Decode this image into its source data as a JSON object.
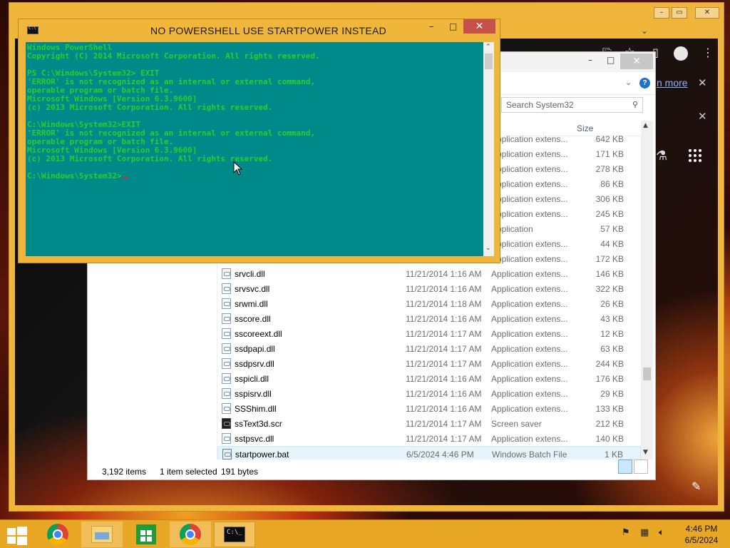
{
  "cmd": {
    "title": "NO POWERSHELL USE STARTPOWER INSTEAD",
    "lines": [
      "Windows PowerShell",
      "Copyright (C) 2014 Microsoft Corporation. All rights reserved.",
      "",
      "PS C:\\Windows\\System32> EXIT",
      "'ERROR' is not recognized as an internal or external command,",
      "operable program or batch file.",
      "Microsoft Windows [Version 6.3.9600]",
      "(c) 2013 Microsoft Corporation. All rights reserved.",
      "",
      "C:\\Windows\\System32>EXIT",
      "'ERROR' is not recognized as an internal or external command,",
      "operable program or batch file.",
      "Microsoft Windows [Version 6.3.9600]",
      "(c) 2013 Microsoft Corporation. All rights reserved.",
      "",
      "C:\\Windows\\System32>"
    ]
  },
  "chrome": {
    "learn_more": "n more"
  },
  "explorer": {
    "search_placeholder": "Search System32",
    "columns": {
      "type": "pe",
      "size": "Size"
    },
    "files": [
      {
        "name": "",
        "date": "",
        "type": "Application extens...",
        "size": "642 KB",
        "icon": "dll"
      },
      {
        "name": "",
        "date": "",
        "type": "Application extens...",
        "size": "171 KB",
        "icon": "dll"
      },
      {
        "name": "",
        "date": "",
        "type": "Application extens...",
        "size": "278 KB",
        "icon": "dll"
      },
      {
        "name": "",
        "date": "",
        "type": "Application extens...",
        "size": "86 KB",
        "icon": "dll"
      },
      {
        "name": "",
        "date": "",
        "type": "Application extens...",
        "size": "306 KB",
        "icon": "dll"
      },
      {
        "name": "",
        "date": "",
        "type": "Application extens...",
        "size": "245 KB",
        "icon": "dll"
      },
      {
        "name": "",
        "date": "",
        "type": "Application",
        "size": "57 KB",
        "icon": "dll"
      },
      {
        "name": "",
        "date": "",
        "type": "Application extens...",
        "size": "44 KB",
        "icon": "dll"
      },
      {
        "name": "",
        "date": "",
        "type": "Application extens...",
        "size": "172 KB",
        "icon": "dll"
      },
      {
        "name": "srvcli.dll",
        "date": "11/21/2014 1:16 AM",
        "type": "Application extens...",
        "size": "146 KB",
        "icon": "dll"
      },
      {
        "name": "srvsvc.dll",
        "date": "11/21/2014 1:16 AM",
        "type": "Application extens...",
        "size": "322 KB",
        "icon": "dll"
      },
      {
        "name": "srwmi.dll",
        "date": "11/21/2014 1:18 AM",
        "type": "Application extens...",
        "size": "26 KB",
        "icon": "dll"
      },
      {
        "name": "sscore.dll",
        "date": "11/21/2014 1:16 AM",
        "type": "Application extens...",
        "size": "43 KB",
        "icon": "dll"
      },
      {
        "name": "sscoreext.dll",
        "date": "11/21/2014 1:17 AM",
        "type": "Application extens...",
        "size": "12 KB",
        "icon": "dll"
      },
      {
        "name": "ssdpapi.dll",
        "date": "11/21/2014 1:17 AM",
        "type": "Application extens...",
        "size": "63 KB",
        "icon": "dll"
      },
      {
        "name": "ssdpsrv.dll",
        "date": "11/21/2014 1:17 AM",
        "type": "Application extens...",
        "size": "244 KB",
        "icon": "dll"
      },
      {
        "name": "sspicli.dll",
        "date": "11/21/2014 1:16 AM",
        "type": "Application extens...",
        "size": "176 KB",
        "icon": "dll"
      },
      {
        "name": "sspisrv.dll",
        "date": "11/21/2014 1:16 AM",
        "type": "Application extens...",
        "size": "29 KB",
        "icon": "dll"
      },
      {
        "name": "SSShim.dll",
        "date": "11/21/2014 1:16 AM",
        "type": "Application extens...",
        "size": "133 KB",
        "icon": "dll"
      },
      {
        "name": "ssText3d.scr",
        "date": "11/21/2014 1:17 AM",
        "type": "Screen saver",
        "size": "212 KB",
        "icon": "scr"
      },
      {
        "name": "sstpsvc.dll",
        "date": "11/21/2014 1:17 AM",
        "type": "Application extens...",
        "size": "140 KB",
        "icon": "dll"
      },
      {
        "name": "startpower.bat",
        "date": "6/5/2024 4:46 PM",
        "type": "Windows Batch File",
        "size": "1 KB",
        "icon": "bat",
        "selected": true
      }
    ],
    "status": {
      "count": "3,192 items",
      "selected": "1 item selected",
      "bytes": "191 bytes"
    }
  },
  "taskbar": {
    "time": "4:46 PM",
    "date": "6/5/2024"
  }
}
